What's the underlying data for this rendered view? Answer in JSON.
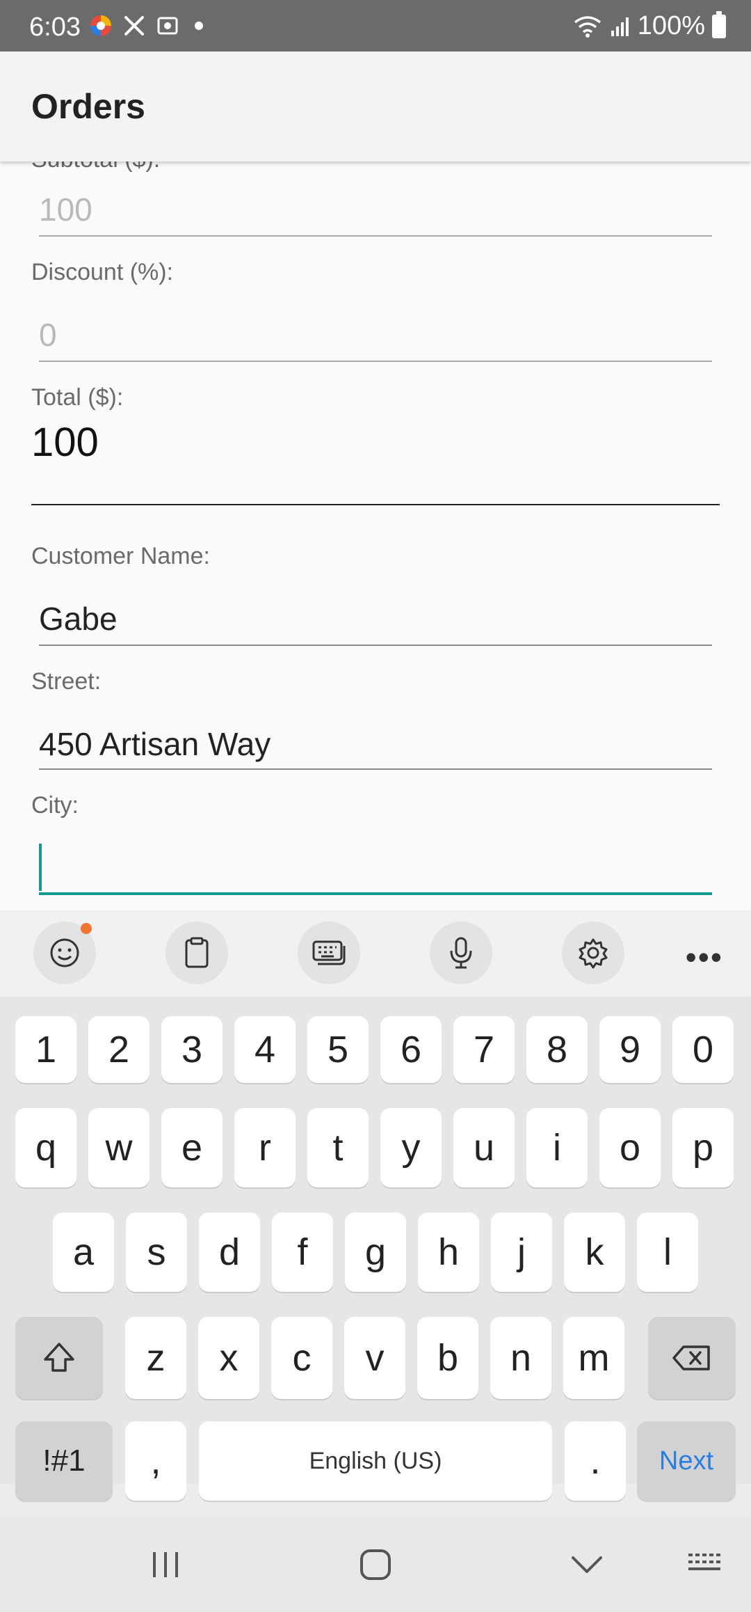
{
  "status_bar": {
    "time": "6:03",
    "battery": "100%"
  },
  "app_bar": {
    "title": "Orders"
  },
  "form": {
    "cutoff_label": "Subtotal ($):",
    "subtotal_value": "100",
    "discount": {
      "label": "Discount (%):",
      "value": "0"
    },
    "total": {
      "label": "Total ($):",
      "value": "100"
    },
    "customer_name": {
      "label": "Customer Name:",
      "value": "Gabe"
    },
    "street": {
      "label": "Street:",
      "value": "450 Artisan Way"
    },
    "city": {
      "label": "City:",
      "value": ""
    }
  },
  "keyboard": {
    "toolbar": [
      "emoji-icon",
      "clipboard-icon",
      "keyboard-mode-icon",
      "mic-icon",
      "settings-icon",
      "more-icon"
    ],
    "row_numbers": [
      "1",
      "2",
      "3",
      "4",
      "5",
      "6",
      "7",
      "8",
      "9",
      "0"
    ],
    "row_top": [
      "q",
      "w",
      "e",
      "r",
      "t",
      "y",
      "u",
      "i",
      "o",
      "p"
    ],
    "row_mid": [
      "a",
      "s",
      "d",
      "f",
      "g",
      "h",
      "j",
      "k",
      "l"
    ],
    "row_bottom": [
      "z",
      "x",
      "c",
      "v",
      "b",
      "n",
      "m"
    ],
    "sym_label": "!#1",
    "comma": ",",
    "space_label": "English (US)",
    "period": ".",
    "next_label": "Next"
  },
  "colors": {
    "accent": "#139a8f",
    "next_key": "#2b7de1",
    "notify_dot": "#ee7630"
  }
}
